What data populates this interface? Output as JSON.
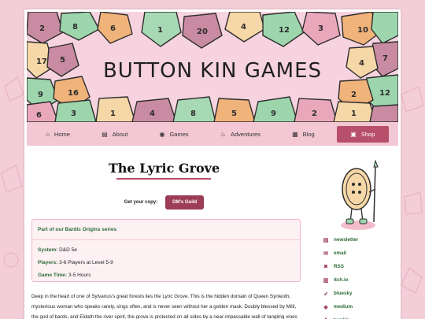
{
  "banner": {
    "title": "BUTTON KIN GAMES"
  },
  "nav": [
    {
      "icon": "home-icon",
      "glyph": "⌂",
      "label": "Home"
    },
    {
      "icon": "book-icon",
      "glyph": "▤",
      "label": "About"
    },
    {
      "icon": "palette-icon",
      "glyph": "◉",
      "label": "Games"
    },
    {
      "icon": "fire-icon",
      "glyph": "♨",
      "label": "Adventures"
    },
    {
      "icon": "newspaper-icon",
      "glyph": "▦",
      "label": "Blog"
    },
    {
      "icon": "bag-icon",
      "glyph": "▣",
      "label": "Shop"
    }
  ],
  "main": {
    "title": "The Lyric Grove",
    "copy_label": "Get your copy:",
    "copy_button": "DM's Guild",
    "info": {
      "series": "Part of our Bardic Origins series",
      "system_label": "System:",
      "system_value": "D&D 5e",
      "players_label": "Players:",
      "players_value": "3-6 Players at Level 5-9",
      "time_label": "Game Time:",
      "time_value": "3-5 Hours"
    },
    "description": "Deep in the heart of one of Sylvanus's great forests lies the Lyric Grove. This is the hidden domain of Queen Synleoth, mysterious woman who speaks rarely, sings often, and is never seen without her a golden mask. Doubly blessed by Milil, the god of bards, and Eldath the river spirit, the grove is protected on all sides by a near-impassable wall of tangling vines and thorns as tall as the tallest tree in this ancient wood."
  },
  "sidebar": {
    "links": [
      {
        "icon": "newsletter-icon",
        "glyph": "▤",
        "label": "newsletter"
      },
      {
        "icon": "email-icon",
        "glyph": "✉",
        "label": "email"
      },
      {
        "icon": "rss-icon",
        "glyph": "◙",
        "label": "RSS"
      },
      {
        "icon": "itchio-icon",
        "glyph": "▥",
        "label": "itch.io"
      },
      {
        "icon": "bluesky-icon",
        "glyph": "➶",
        "label": "bluesky"
      },
      {
        "icon": "mastodon-icon",
        "glyph": "◈",
        "label": "medium"
      },
      {
        "icon": "tumblr-icon",
        "glyph": "t",
        "label": "tumblr"
      }
    ]
  },
  "colors": {
    "accent": "#b84f6a",
    "button": "#9c3c55",
    "link_green": "#2a6b35",
    "background": "#f3cdd8"
  }
}
